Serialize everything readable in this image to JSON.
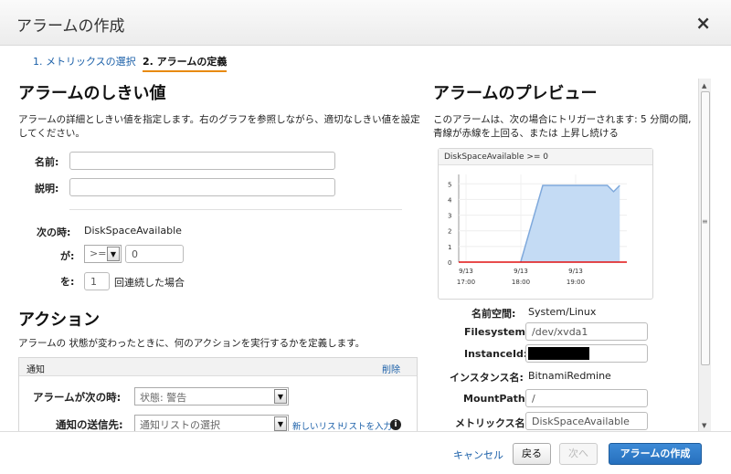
{
  "dialog": {
    "title": "アラームの作成",
    "close_icon": "×"
  },
  "steps": [
    {
      "label": "1. メトリックスの選択"
    },
    {
      "label": "2. アラームの定義"
    }
  ],
  "threshold": {
    "heading": "アラームのしきい値",
    "description": "アラームの詳細としきい値を指定します。右のグラフを参照しながら、適切なしきい値を設定してください。",
    "name_label": "名前:",
    "name_value": "",
    "desc_label": "説明:",
    "desc_value": "",
    "when_label": "次の時:",
    "when_value": "DiskSpaceAvailable",
    "is_label": "が:",
    "operator": ">=",
    "threshold_value": "0",
    "for_label": "を:",
    "periods_value": "1",
    "periods_suffix": "回連続した場合"
  },
  "actions": {
    "heading": "アクション",
    "description": "アラームの 状態が変わったときに、何のアクションを実行するかを定義します。",
    "panel_title": "通知",
    "delete_link": "削除",
    "state_label": "アラームが次の時:",
    "state_value": "状態: 警告",
    "send_label": "通知の送信先:",
    "send_value": "通知リストの選択",
    "new_list_link": "新しいリスト",
    "enter_list_link": "リストを入力"
  },
  "preview": {
    "heading": "アラームのプレビュー",
    "description": "このアラームは、次の場合にトリガーされます: 5 分間の間, 青線が赤線を上回る、または 上昇し続ける",
    "namespace_label": "名前空間:",
    "namespace_value": "System/Linux",
    "filesystem_label": "Filesystem:",
    "filesystem_value": "/dev/xvda1",
    "instanceid_label": "InstanceId:",
    "instanceid_value": "",
    "instancename_label": "インスタンス名:",
    "instancename_value": "BitnamiRedmine",
    "mountpath_label": "MountPath:",
    "mountpath_value": "/",
    "metric_label": "メトリックス名:",
    "metric_value": "DiskSpaceAvailable"
  },
  "chart_data": {
    "type": "area",
    "title": "DiskSpaceAvailable >= 0",
    "x_ticks": [
      [
        "9/13",
        "17:00"
      ],
      [
        "9/13",
        "18:00"
      ],
      [
        "9/13",
        "19:00"
      ]
    ],
    "y_ticks": [
      0,
      1,
      2,
      3,
      4,
      5
    ],
    "ylim": [
      0,
      5.6
    ],
    "x": [
      0,
      0.25,
      0.5,
      0.75,
      1.0,
      1.25,
      1.48,
      1.55,
      1.62
    ],
    "series": [
      {
        "values": [
          null,
          null,
          0,
          4.9,
          4.9,
          4.9,
          4.9,
          4.5,
          4.9
        ],
        "color": "#7fa9dc"
      }
    ],
    "threshold": 0,
    "threshold_color": "#e01010",
    "xlim": [
      -0.2,
      1.7
    ]
  },
  "footer": {
    "cancel": "キャンセル",
    "back": "戻る",
    "next": "次へ",
    "create": "アラームの作成"
  }
}
